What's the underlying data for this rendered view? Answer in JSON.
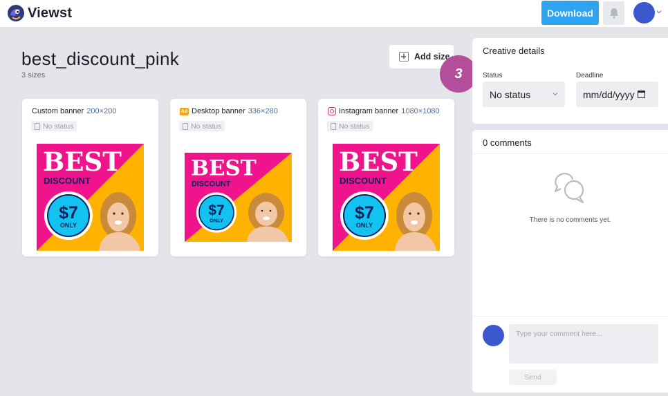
{
  "app": {
    "name": "Viewst",
    "download_label": "Download"
  },
  "creative": {
    "title": "best_discount_pink",
    "sizes_count": "3 sizes",
    "add_size_label": "Add size",
    "step_badge": "3"
  },
  "cards": [
    {
      "name": "Custom banner",
      "dims": "200×200",
      "status": "No status",
      "icon": "none"
    },
    {
      "name": "Desktop banner",
      "dims": "336×280",
      "status": "No status",
      "icon": "ad-icon",
      "icon_text": "Ad"
    },
    {
      "name": "Instagram banner",
      "dims": "1080×1080",
      "status": "No status",
      "icon": "instagram-icon"
    }
  ],
  "banner": {
    "headline": "BEST",
    "subhead": "DISCOUNT",
    "price": "$7",
    "price_note": "ONLY",
    "colors": {
      "pink": "#f0148c",
      "yellow": "#ffb300",
      "cyan": "#12c2f0",
      "navy": "#0d1f5c"
    }
  },
  "details": {
    "title": "Creative details",
    "status_label": "Status",
    "status_value": "No status",
    "deadline_label": "Deadline",
    "deadline_placeholder": "mm/dd/yyyy"
  },
  "comments": {
    "title": "0 comments",
    "empty_text": "There is no comments yet.",
    "input_placeholder": "Type your comment here...",
    "send_label": "Send"
  },
  "colors": {
    "accent": "#2ea3f2",
    "avatar": "#3b57cc",
    "step_badge": "#b34f9a"
  }
}
